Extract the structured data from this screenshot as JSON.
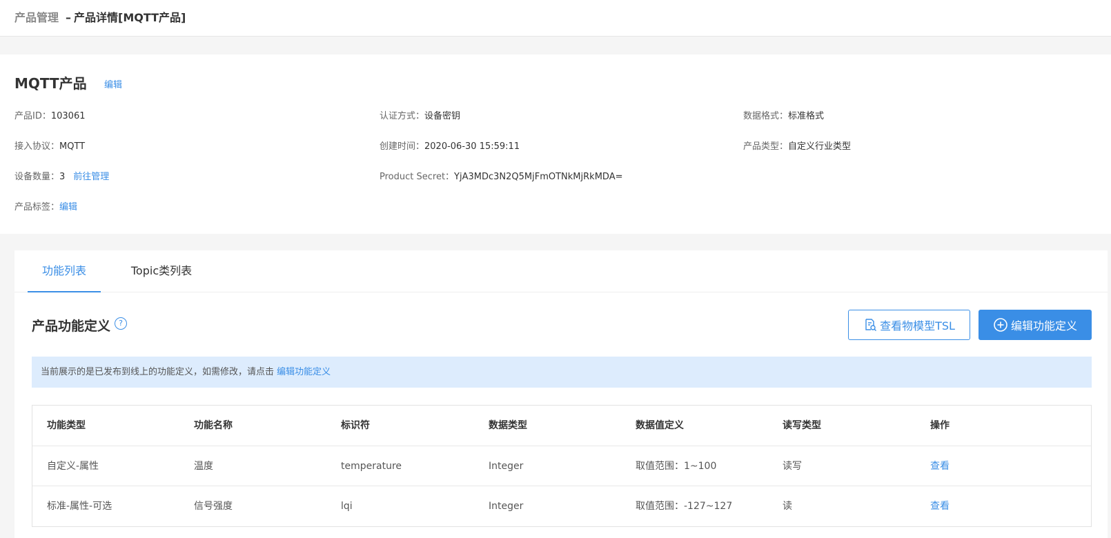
{
  "breadcrumb": {
    "root": "产品管理",
    "separator": "–",
    "current": "产品详情[MQTT产品]"
  },
  "product": {
    "name": "MQTT产品",
    "edit_label": "编辑",
    "fields": {
      "product_id": {
        "label": "产品ID：",
        "value": "103061"
      },
      "auth_method": {
        "label": "认证方式：",
        "value": "设备密钥"
      },
      "data_format": {
        "label": "数据格式：",
        "value": "标准格式"
      },
      "protocol": {
        "label": "接入协议：",
        "value": "MQTT"
      },
      "created_time": {
        "label": "创建时间：",
        "value": "2020-06-30 15:59:11"
      },
      "product_type": {
        "label": "产品类型：",
        "value": "自定义行业类型"
      },
      "device_count": {
        "label": "设备数量：",
        "value": "3",
        "link": "前往管理"
      },
      "product_secret": {
        "label": "Product Secret：",
        "value": "YjA3MDc3N2Q5MjFmOTNkMjRkMDA="
      },
      "tags": {
        "label": "产品标签：",
        "link": "编辑"
      }
    }
  },
  "tabs": [
    {
      "label": "功能列表",
      "active": true
    },
    {
      "label": "Topic类列表",
      "active": false
    }
  ],
  "section": {
    "title": "产品功能定义",
    "help_glyph": "?",
    "view_tsl_label": "查看物模型TSL",
    "edit_def_label": "编辑功能定义"
  },
  "notice": {
    "text": "当前展示的是已发布到线上的功能定义，如需修改，请点击 ",
    "link": "编辑功能定义"
  },
  "table": {
    "headers": [
      "功能类型",
      "功能名称",
      "标识符",
      "数据类型",
      "数据值定义",
      "读写类型",
      "操作"
    ],
    "rows": [
      [
        "自定义-属性",
        "温度",
        "temperature",
        "Integer",
        "取值范围：1~100",
        "读写",
        "查看"
      ],
      [
        "标准-属性-可选",
        "信号强度",
        "lqi",
        "Integer",
        "取值范围：-127~127",
        "读",
        "查看"
      ]
    ]
  },
  "colors": {
    "accent": "#3a8ee6",
    "notice_bg": "#ddecfd"
  },
  "icons": {
    "view_tsl": "document-search-icon",
    "edit_def": "plus-circle-icon",
    "help": "question-circle-icon"
  }
}
